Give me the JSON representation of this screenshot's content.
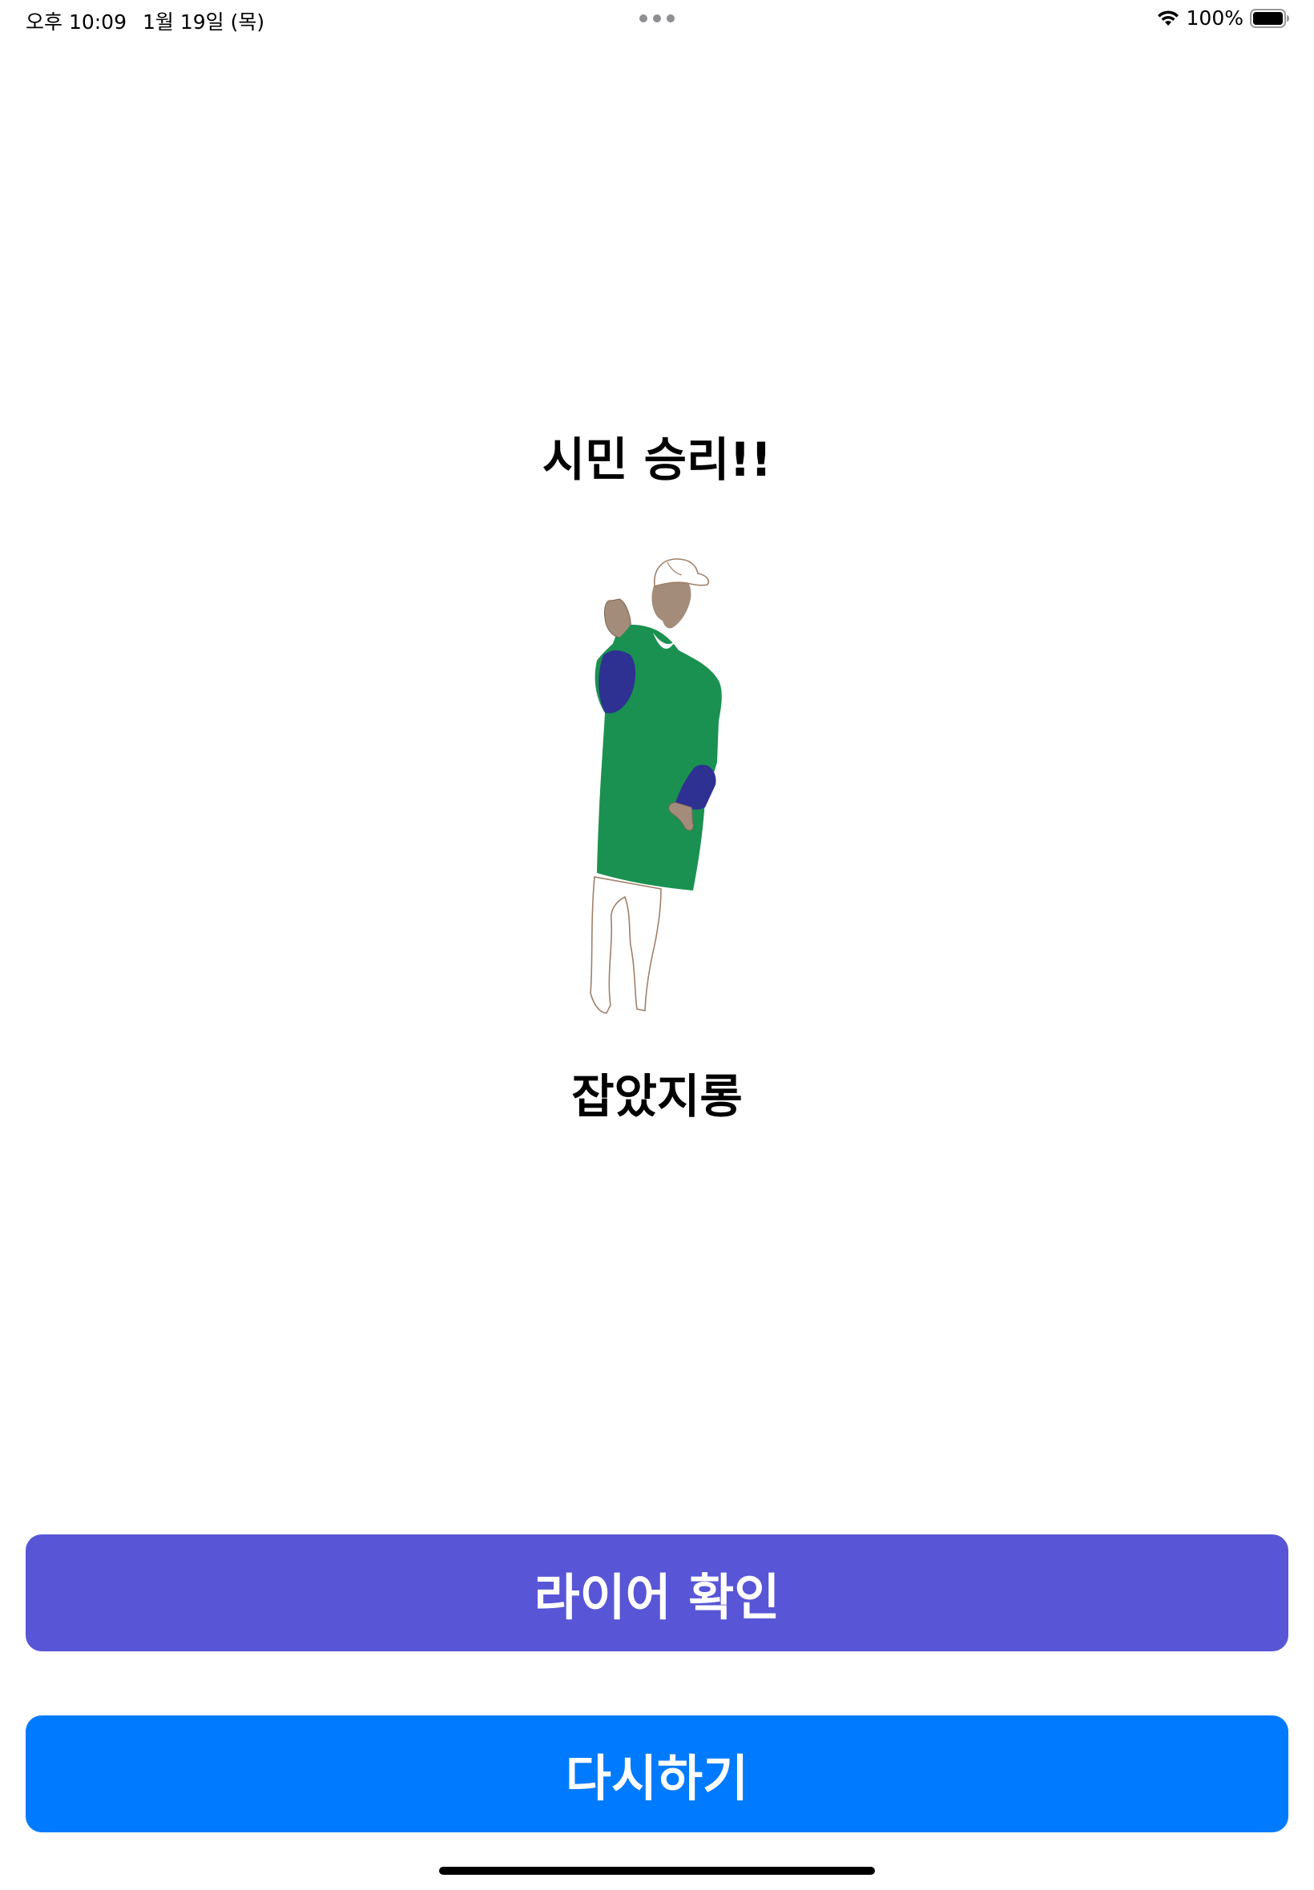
{
  "status_bar": {
    "time": "오후 10:09",
    "date": "1월 19일 (목)",
    "battery_percent": "100%",
    "wifi_icon": "wifi-icon",
    "battery_icon": "battery-icon",
    "battery_level": 1.0
  },
  "result": {
    "title": "시민 승리!!",
    "subtitle": "잡았지롱",
    "illustration": "dancing-person-illustration"
  },
  "buttons": {
    "liar_check": "라이어 확인",
    "retry": "다시하기"
  },
  "colors": {
    "liar_button": "#5856d6",
    "retry_button": "#007aff",
    "shirt": "#1a9150",
    "sleeve": "#2e3192",
    "skin": "#a38c7a"
  }
}
